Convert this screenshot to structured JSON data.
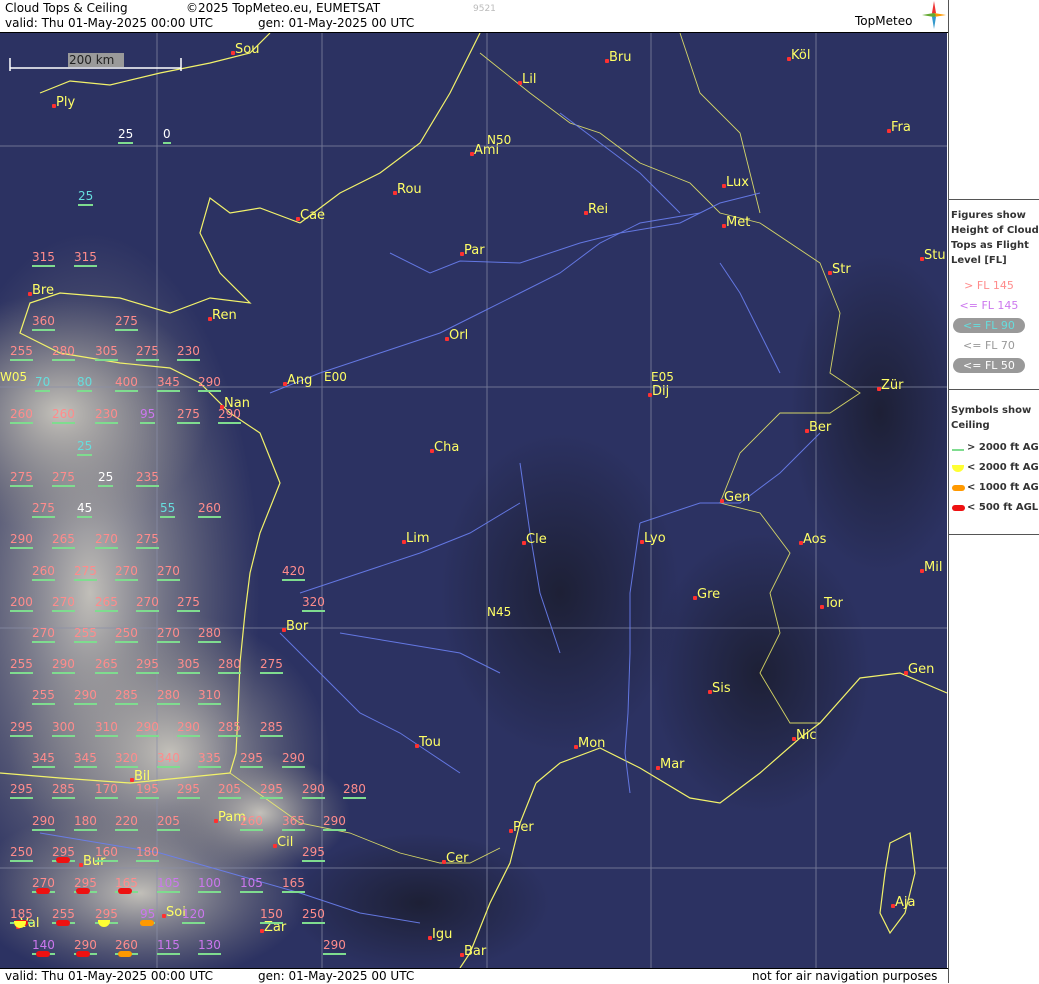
{
  "header": {
    "title": "Cloud Tops & Ceiling",
    "copyright": "©2025 TopMeteo.eu, EUMETSAT",
    "code": "9521",
    "valid": "valid:  Thu  01-May-2025  00:00 UTC",
    "gen": "gen: 01-May-2025 00 UTC",
    "logo": "TopMeteo"
  },
  "footer": {
    "valid": "valid:  Thu  01-May-2025  00:00 UTC",
    "gen": "gen: 01-May-2025 00 UTC",
    "note": "not for air navigation purposes"
  },
  "scale": {
    "label": "200 km"
  },
  "legend": {
    "figures_title": "Figures show Height of Cloud Tops as Flight Level  [FL]",
    "figures": [
      {
        "label": "> FL 145",
        "color": "#ff8c8c",
        "oval": false
      },
      {
        "label": "<= FL 145",
        "color": "#cc77ee",
        "oval": false
      },
      {
        "label": "<= FL 90",
        "color": "#66dddd",
        "oval": true
      },
      {
        "label": "<= FL 70",
        "color": "#999999",
        "oval": false
      },
      {
        "label": "<= FL 50",
        "color": "#ffffff",
        "oval": true
      }
    ],
    "symbols_title": "Symbols show Ceiling",
    "symbols": [
      {
        "label": "> 2000 ft AGL",
        "color": "#7fdc8f",
        "type": "line"
      },
      {
        "label": "< 2000 ft AGL",
        "color": "#ffff33",
        "type": "half"
      },
      {
        "label": "< 1000 ft AGL",
        "color": "#ff9900",
        "type": "pill"
      },
      {
        "label": "< 500 ft AGL",
        "color": "#ee1111",
        "type": "pill"
      }
    ]
  },
  "grid_labels": [
    {
      "text": "N50"
    },
    {
      "text": "N45"
    },
    {
      "text": "E00"
    },
    {
      "text": "E05"
    },
    {
      "text": "W05"
    }
  ],
  "cities": [
    {
      "name": "Sou"
    },
    {
      "name": "Ply"
    },
    {
      "name": "Bru"
    },
    {
      "name": "Köl"
    },
    {
      "name": "Lil"
    },
    {
      "name": "Ami"
    },
    {
      "name": "Fra"
    },
    {
      "name": "Rou"
    },
    {
      "name": "Lux"
    },
    {
      "name": "Cae"
    },
    {
      "name": "Rei"
    },
    {
      "name": "Met"
    },
    {
      "name": "Par"
    },
    {
      "name": "Str"
    },
    {
      "name": "Stu"
    },
    {
      "name": "Bre"
    },
    {
      "name": "Ren"
    },
    {
      "name": "Orl"
    },
    {
      "name": "Ang"
    },
    {
      "name": "Nan"
    },
    {
      "name": "Dij"
    },
    {
      "name": "Zür"
    },
    {
      "name": "Cha"
    },
    {
      "name": "Ber"
    },
    {
      "name": "Gen"
    },
    {
      "name": "Lim"
    },
    {
      "name": "Cle"
    },
    {
      "name": "Lyo"
    },
    {
      "name": "Aos"
    },
    {
      "name": "Mil"
    },
    {
      "name": "Gre"
    },
    {
      "name": "Tor"
    },
    {
      "name": "Bor"
    },
    {
      "name": "Gen"
    },
    {
      "name": "Sis"
    },
    {
      "name": "Nic"
    },
    {
      "name": "Tou"
    },
    {
      "name": "Mon"
    },
    {
      "name": "Mar"
    },
    {
      "name": "Bil"
    },
    {
      "name": "Pam"
    },
    {
      "name": "Cil"
    },
    {
      "name": "Per"
    },
    {
      "name": "Bur"
    },
    {
      "name": "Cer"
    },
    {
      "name": "Soi"
    },
    {
      "name": "Aja"
    },
    {
      "name": "Val"
    },
    {
      "name": "Zar"
    },
    {
      "name": "Igu"
    },
    {
      "name": "Bar"
    }
  ],
  "cloud_tops": [
    {
      "v": "25",
      "c": "w"
    },
    {
      "v": "0",
      "c": "w"
    },
    {
      "v": "25",
      "c": "c"
    },
    {
      "v": "315",
      "c": "r"
    },
    {
      "v": "315",
      "c": "r"
    },
    {
      "v": "360",
      "c": "r"
    },
    {
      "v": "275",
      "c": "r"
    },
    {
      "v": "255",
      "c": "r"
    },
    {
      "v": "280",
      "c": "r"
    },
    {
      "v": "305",
      "c": "r"
    },
    {
      "v": "275",
      "c": "r"
    },
    {
      "v": "230",
      "c": "r"
    },
    {
      "v": "70",
      "c": "c"
    },
    {
      "v": "80",
      "c": "c"
    },
    {
      "v": "400",
      "c": "r"
    },
    {
      "v": "345",
      "c": "r"
    },
    {
      "v": "290",
      "c": "r"
    },
    {
      "v": "260",
      "c": "r"
    },
    {
      "v": "260",
      "c": "r"
    },
    {
      "v": "230",
      "c": "r"
    },
    {
      "v": "95",
      "c": "m"
    },
    {
      "v": "275",
      "c": "r"
    },
    {
      "v": "290",
      "c": "r"
    },
    {
      "v": "25",
      "c": "c"
    },
    {
      "v": "275",
      "c": "r"
    },
    {
      "v": "275",
      "c": "r"
    },
    {
      "v": "25",
      "c": "w"
    },
    {
      "v": "235",
      "c": "r"
    },
    {
      "v": "275",
      "c": "r"
    },
    {
      "v": "45",
      "c": "w"
    },
    {
      "v": "55",
      "c": "c"
    },
    {
      "v": "260",
      "c": "r"
    },
    {
      "v": "290",
      "c": "r"
    },
    {
      "v": "265",
      "c": "r"
    },
    {
      "v": "270",
      "c": "r"
    },
    {
      "v": "275",
      "c": "r"
    },
    {
      "v": "260",
      "c": "r"
    },
    {
      "v": "275",
      "c": "r"
    },
    {
      "v": "270",
      "c": "r"
    },
    {
      "v": "270",
      "c": "r"
    },
    {
      "v": "420",
      "c": "r"
    },
    {
      "v": "200",
      "c": "r"
    },
    {
      "v": "270",
      "c": "r"
    },
    {
      "v": "265",
      "c": "r"
    },
    {
      "v": "270",
      "c": "r"
    },
    {
      "v": "275",
      "c": "r"
    },
    {
      "v": "320",
      "c": "r"
    },
    {
      "v": "270",
      "c": "r"
    },
    {
      "v": "255",
      "c": "r"
    },
    {
      "v": "250",
      "c": "r"
    },
    {
      "v": "270",
      "c": "r"
    },
    {
      "v": "280",
      "c": "r"
    },
    {
      "v": "255",
      "c": "r"
    },
    {
      "v": "290",
      "c": "r"
    },
    {
      "v": "265",
      "c": "r"
    },
    {
      "v": "295",
      "c": "r"
    },
    {
      "v": "305",
      "c": "r"
    },
    {
      "v": "280",
      "c": "r"
    },
    {
      "v": "275",
      "c": "r"
    },
    {
      "v": "255",
      "c": "r"
    },
    {
      "v": "290",
      "c": "r"
    },
    {
      "v": "285",
      "c": "r"
    },
    {
      "v": "280",
      "c": "r"
    },
    {
      "v": "310",
      "c": "r"
    },
    {
      "v": "295",
      "c": "r"
    },
    {
      "v": "300",
      "c": "r"
    },
    {
      "v": "310",
      "c": "r"
    },
    {
      "v": "290",
      "c": "r"
    },
    {
      "v": "290",
      "c": "r"
    },
    {
      "v": "285",
      "c": "r"
    },
    {
      "v": "285",
      "c": "r"
    },
    {
      "v": "345",
      "c": "r"
    },
    {
      "v": "345",
      "c": "r"
    },
    {
      "v": "320",
      "c": "r"
    },
    {
      "v": "340",
      "c": "r"
    },
    {
      "v": "335",
      "c": "r"
    },
    {
      "v": "295",
      "c": "r"
    },
    {
      "v": "290",
      "c": "r"
    },
    {
      "v": "295",
      "c": "r"
    },
    {
      "v": "285",
      "c": "r"
    },
    {
      "v": "170",
      "c": "r"
    },
    {
      "v": "195",
      "c": "r"
    },
    {
      "v": "295",
      "c": "r"
    },
    {
      "v": "205",
      "c": "r"
    },
    {
      "v": "295",
      "c": "r"
    },
    {
      "v": "290",
      "c": "r"
    },
    {
      "v": "280",
      "c": "r"
    },
    {
      "v": "290",
      "c": "r"
    },
    {
      "v": "180",
      "c": "r"
    },
    {
      "v": "220",
      "c": "r"
    },
    {
      "v": "205",
      "c": "r"
    },
    {
      "v": "260",
      "c": "r"
    },
    {
      "v": "365",
      "c": "r"
    },
    {
      "v": "290",
      "c": "r"
    },
    {
      "v": "250",
      "c": "r"
    },
    {
      "v": "295",
      "c": "r"
    },
    {
      "v": "160",
      "c": "r"
    },
    {
      "v": "180",
      "c": "r"
    },
    {
      "v": "295",
      "c": "r"
    },
    {
      "v": "270",
      "c": "r"
    },
    {
      "v": "295",
      "c": "r"
    },
    {
      "v": "165",
      "c": "r"
    },
    {
      "v": "105",
      "c": "m"
    },
    {
      "v": "100",
      "c": "m"
    },
    {
      "v": "105",
      "c": "m"
    },
    {
      "v": "165",
      "c": "r"
    },
    {
      "v": "185",
      "c": "r"
    },
    {
      "v": "255",
      "c": "r"
    },
    {
      "v": "295",
      "c": "r"
    },
    {
      "v": "95",
      "c": "m"
    },
    {
      "v": "120",
      "c": "m"
    },
    {
      "v": "150",
      "c": "r"
    },
    {
      "v": "250",
      "c": "r"
    },
    {
      "v": "140",
      "c": "m"
    },
    {
      "v": "290",
      "c": "r"
    },
    {
      "v": "260",
      "c": "r"
    },
    {
      "v": "115",
      "c": "m"
    },
    {
      "v": "130",
      "c": "m"
    },
    {
      "v": "290",
      "c": "r"
    }
  ],
  "cloud_colors": {
    "r": "#ff8c8c",
    "m": "#cc77ee",
    "c": "#66dddd",
    "w": "#ffffff",
    "under": "#7fdc8f"
  }
}
